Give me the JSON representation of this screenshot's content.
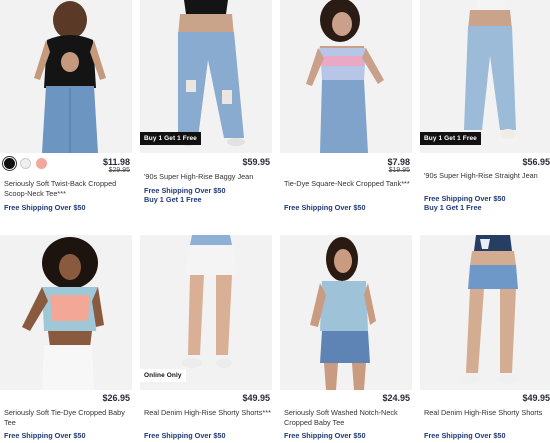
{
  "products": [
    {
      "name": "Seriously Soft Twist-Back Cropped Scoop-Neck Tee***",
      "price": "$11.98",
      "was_price": "$29.95",
      "swatches": [
        "black",
        "white",
        "pink"
      ],
      "promos": [
        "Free Shipping Over $50"
      ],
      "badge": ""
    },
    {
      "name": "'90s Super High-Rise Baggy Jean",
      "price": "$59.95",
      "promos": [
        "Free Shipping Over $50",
        "Buy 1 Get 1 Free"
      ],
      "badge": "Buy 1 Get 1 Free"
    },
    {
      "name": "Tie-Dye Square-Neck Cropped Tank***",
      "price": "$7.98",
      "was_price": "$19.95",
      "promos": [
        "Free Shipping Over $50"
      ],
      "badge": ""
    },
    {
      "name": "'90s Super High-Rise Straight Jean",
      "price": "$56.95",
      "promos": [
        "Free Shipping Over $50",
        "Buy 1 Get 1 Free"
      ],
      "badge": "Buy 1 Get 1 Free"
    },
    {
      "name": "Seriously Soft Tie-Dye Cropped Baby Tee",
      "price": "$26.95",
      "promos": [
        "Free Shipping Over $50"
      ],
      "badge": ""
    },
    {
      "name": "Real Denim High-Rise Shorty Shorts***",
      "price": "$49.95",
      "promos": [
        "Free Shipping Over $50"
      ],
      "badge": "Online Only"
    },
    {
      "name": "Seriously Soft Washed Notch-Neck Cropped Baby Tee",
      "price": "$24.95",
      "promos": [
        "Free Shipping Over $50"
      ],
      "badge": ""
    },
    {
      "name": "Real Denim High-Rise Shorty Shorts",
      "price": "$49.95",
      "promos": [
        "Free Shipping Over $50"
      ],
      "badge": ""
    }
  ],
  "colors": {
    "promo_text": "#1f3a7a",
    "price_text": "#2b2b38",
    "photo_bg": "#f3f2f2",
    "badge_bg": "#111111"
  }
}
